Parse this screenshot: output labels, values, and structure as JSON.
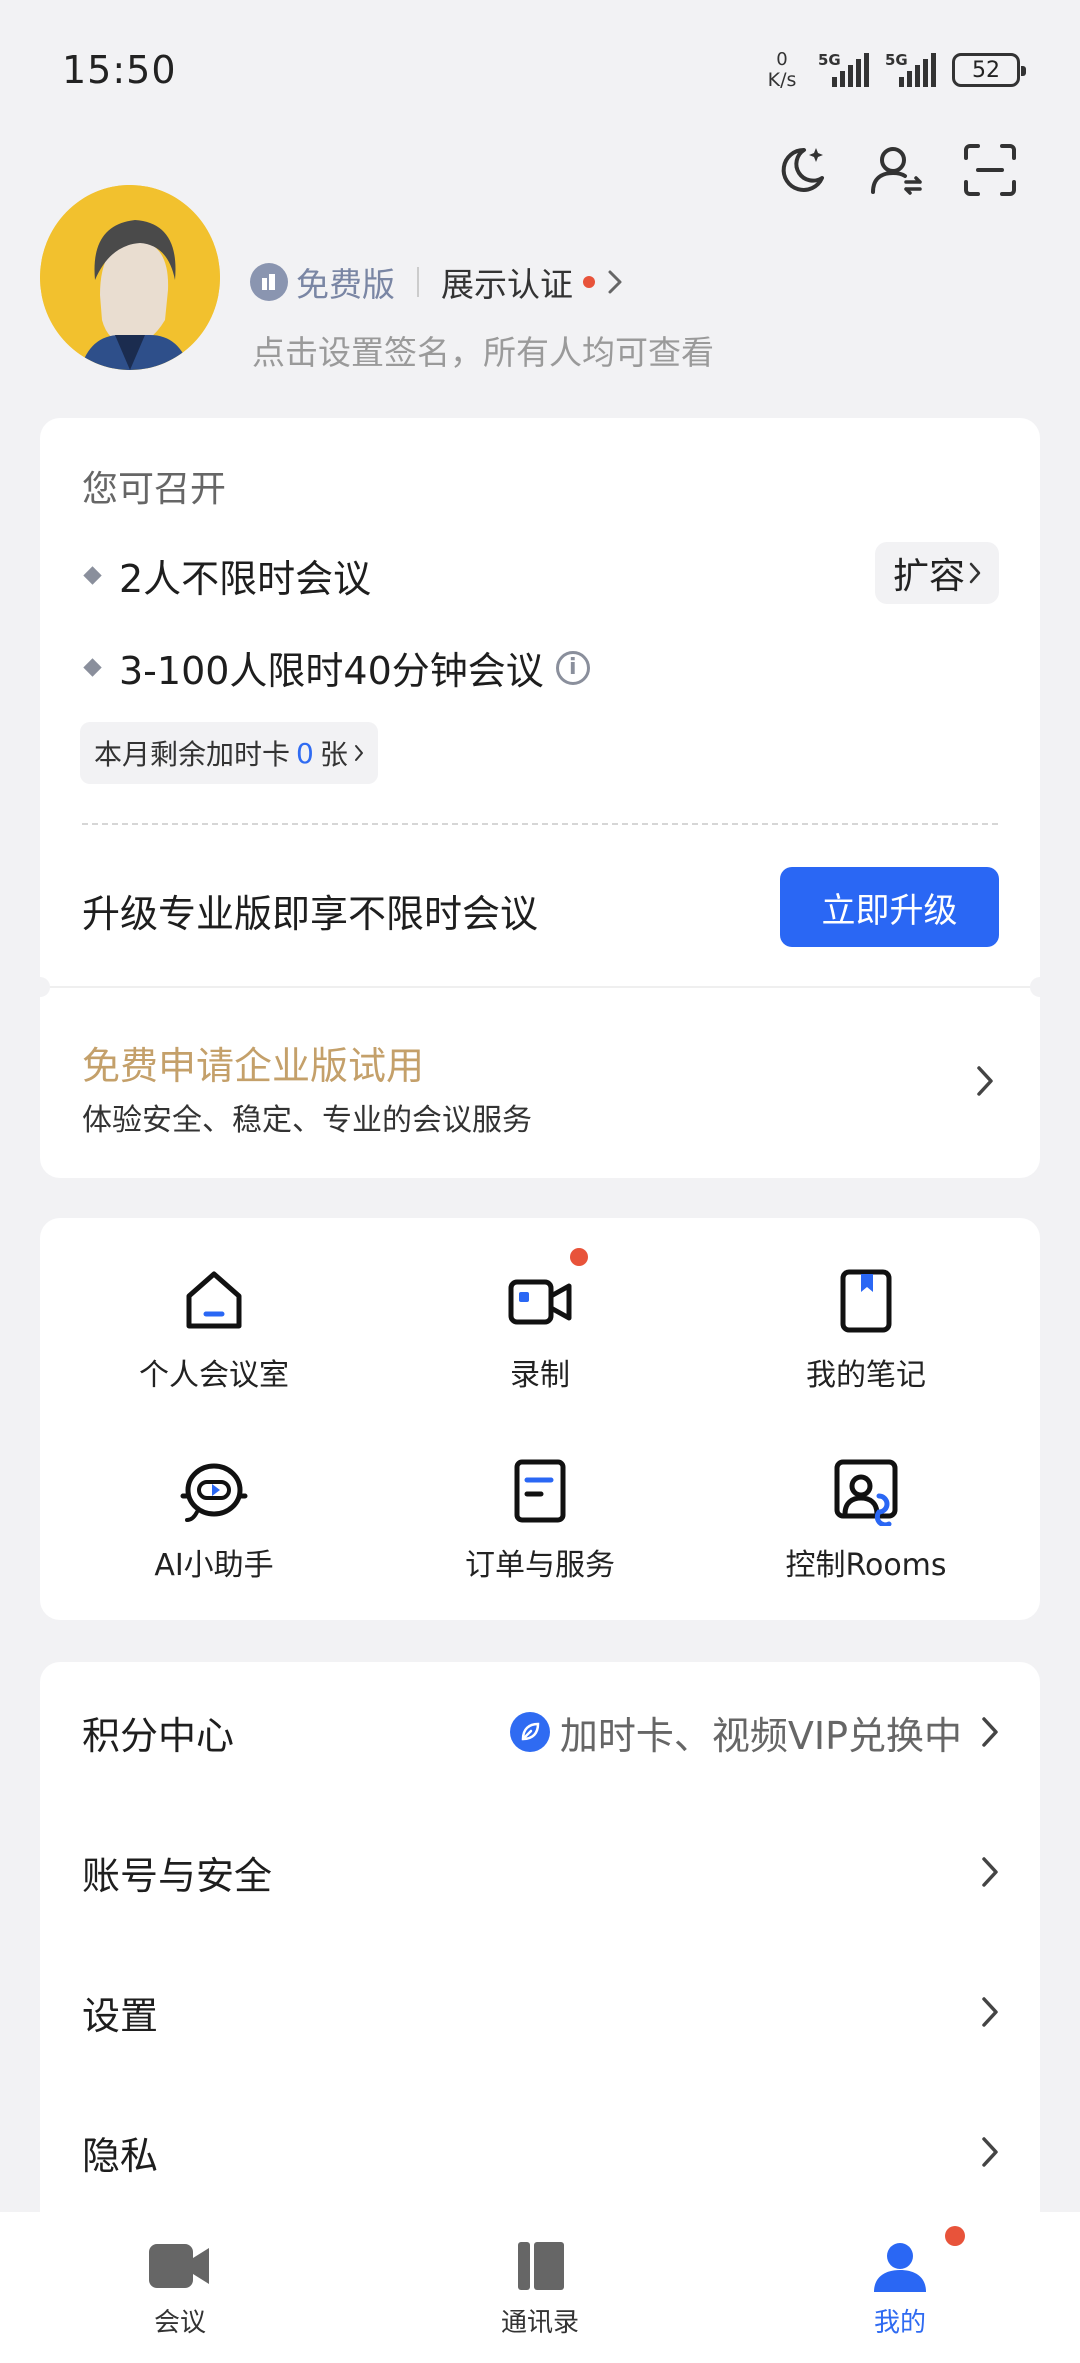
{
  "status_bar": {
    "time": "15:50",
    "net_speed_value": "0",
    "net_speed_unit": "K/s",
    "signal1_label": "5G",
    "signal2_label": "5G",
    "battery": "52"
  },
  "profile": {
    "plan_label": "免费版",
    "certification_label": "展示认证",
    "signature_hint": "点击设置签名，所有人均可查看"
  },
  "meeting_card": {
    "title": "您可召开",
    "item1": "2人不限时会议",
    "item2": "3-100人限时40分钟会议",
    "expand_label": "扩容",
    "card_count_prefix": "本月剩余加时卡",
    "card_count_value": "0",
    "card_count_suffix": "张",
    "upgrade_text": "升级专业版即享不限时会议",
    "upgrade_button": "立即升级",
    "trial_title": "免费申请企业版试用",
    "trial_subtitle": "体验安全、稳定、专业的会议服务"
  },
  "feature_grid": {
    "items": [
      {
        "label": "个人会议室",
        "icon": "personal-room-icon"
      },
      {
        "label": "录制",
        "icon": "recording-camera-icon"
      },
      {
        "label": "我的笔记",
        "icon": "notes-icon"
      },
      {
        "label": "AI小助手",
        "icon": "ai-assistant-icon"
      },
      {
        "label": "订单与服务",
        "icon": "orders-icon"
      },
      {
        "label": "控制Rooms",
        "icon": "rooms-control-icon"
      }
    ]
  },
  "menu": {
    "points_label": "积分中心",
    "points_promo": "加时卡、视频VIP兑换中",
    "account_label": "账号与安全",
    "settings_label": "设置",
    "privacy_label": "隐私"
  },
  "tabs": [
    {
      "label": "会议"
    },
    {
      "label": "通讯录"
    },
    {
      "label": "我的"
    }
  ],
  "colors": {
    "accent": "#2a67f4",
    "trial_gold": "#c4a06a",
    "badge_red": "#e8533a",
    "background": "#f2f2f4"
  }
}
